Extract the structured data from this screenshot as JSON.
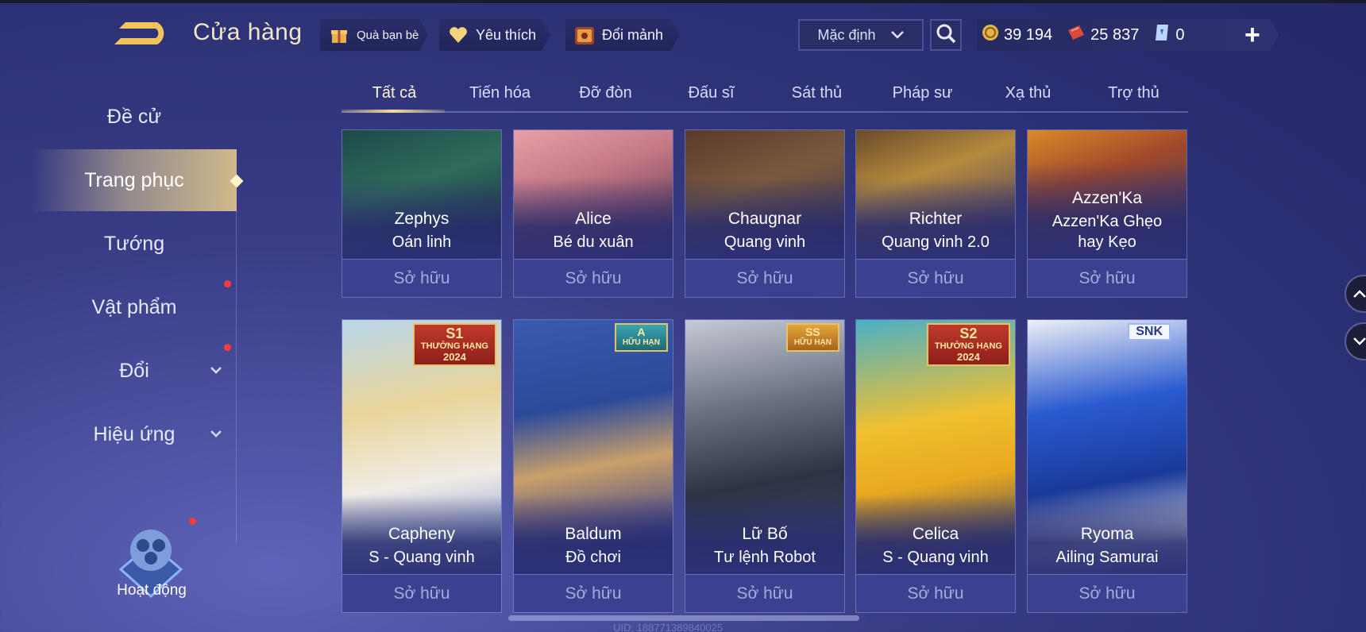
{
  "header": {
    "title": "Cửa hàng",
    "chips": [
      {
        "label": "Quà bạn bè",
        "icon": "gift-icon"
      },
      {
        "label": "Yêu thích",
        "icon": "heart-icon"
      },
      {
        "label": "Đổi mảnh",
        "icon": "shard-chest-icon"
      }
    ],
    "sort": {
      "selected": "Mặc định"
    },
    "currencies": [
      {
        "value": "39 194",
        "icon": "gold-coin-icon"
      },
      {
        "value": "25 837",
        "icon": "voucher-icon"
      },
      {
        "value": "0",
        "icon": "diamond-card-icon"
      }
    ]
  },
  "sidebar": {
    "items": [
      {
        "label": "Đề cử"
      },
      {
        "label": "Trang phục"
      },
      {
        "label": "Tướng"
      },
      {
        "label": "Vật phẩm"
      },
      {
        "label": "Đổi"
      },
      {
        "label": "Hiệu ứng"
      }
    ],
    "activity_label": "Hoạt động"
  },
  "tabs": [
    "Tất cả",
    "Tiến hóa",
    "Đỡ đòn",
    "Đấu sĩ",
    "Sát thủ",
    "Pháp sư",
    "Xạ thủ",
    "Trợ thủ"
  ],
  "cards_row1": [
    {
      "hero": "Zephys",
      "skin": "Oán linh",
      "status": "Sở hữu"
    },
    {
      "hero": "Alice",
      "skin": "Bé du xuân",
      "status": "Sở hữu"
    },
    {
      "hero": "Chaugnar",
      "skin": "Quang vinh",
      "status": "Sở hữu"
    },
    {
      "hero": "Richter",
      "skin": "Quang vinh 2.0",
      "status": "Sở hữu"
    },
    {
      "hero": "Azzen'Ka",
      "skin": "Azzen'Ka Ghẹo hay Kẹo",
      "status": "Sở hữu"
    }
  ],
  "cards_row2": [
    {
      "hero": "Capheny",
      "skin": "S - Quang vinh",
      "status": "Sở hữu",
      "badge_top": "S1",
      "badge_mid": "THƯỞNG HẠNG",
      "badge_bottom": "2024"
    },
    {
      "hero": "Baldum",
      "skin": "Đồ chơi",
      "status": "Sở hữu",
      "badge_top": "A",
      "badge_mid": "HỮU HẠN"
    },
    {
      "hero": "Lữ Bố",
      "skin": "Tư lệnh Robot",
      "status": "Sở hữu",
      "badge_top": "SS",
      "badge_mid": "HỮU HẠN"
    },
    {
      "hero": "Celica",
      "skin": "S - Quang vinh",
      "status": "Sở hữu",
      "badge_top": "S2",
      "badge_mid": "THƯỞNG HẠNG",
      "badge_bottom": "2024"
    },
    {
      "hero": "Ryoma",
      "skin": "Ailing Samurai",
      "status": "Sở hữu",
      "badge_top": "SNK"
    }
  ],
  "footer": {
    "uid": "UID: 188771389840025"
  }
}
